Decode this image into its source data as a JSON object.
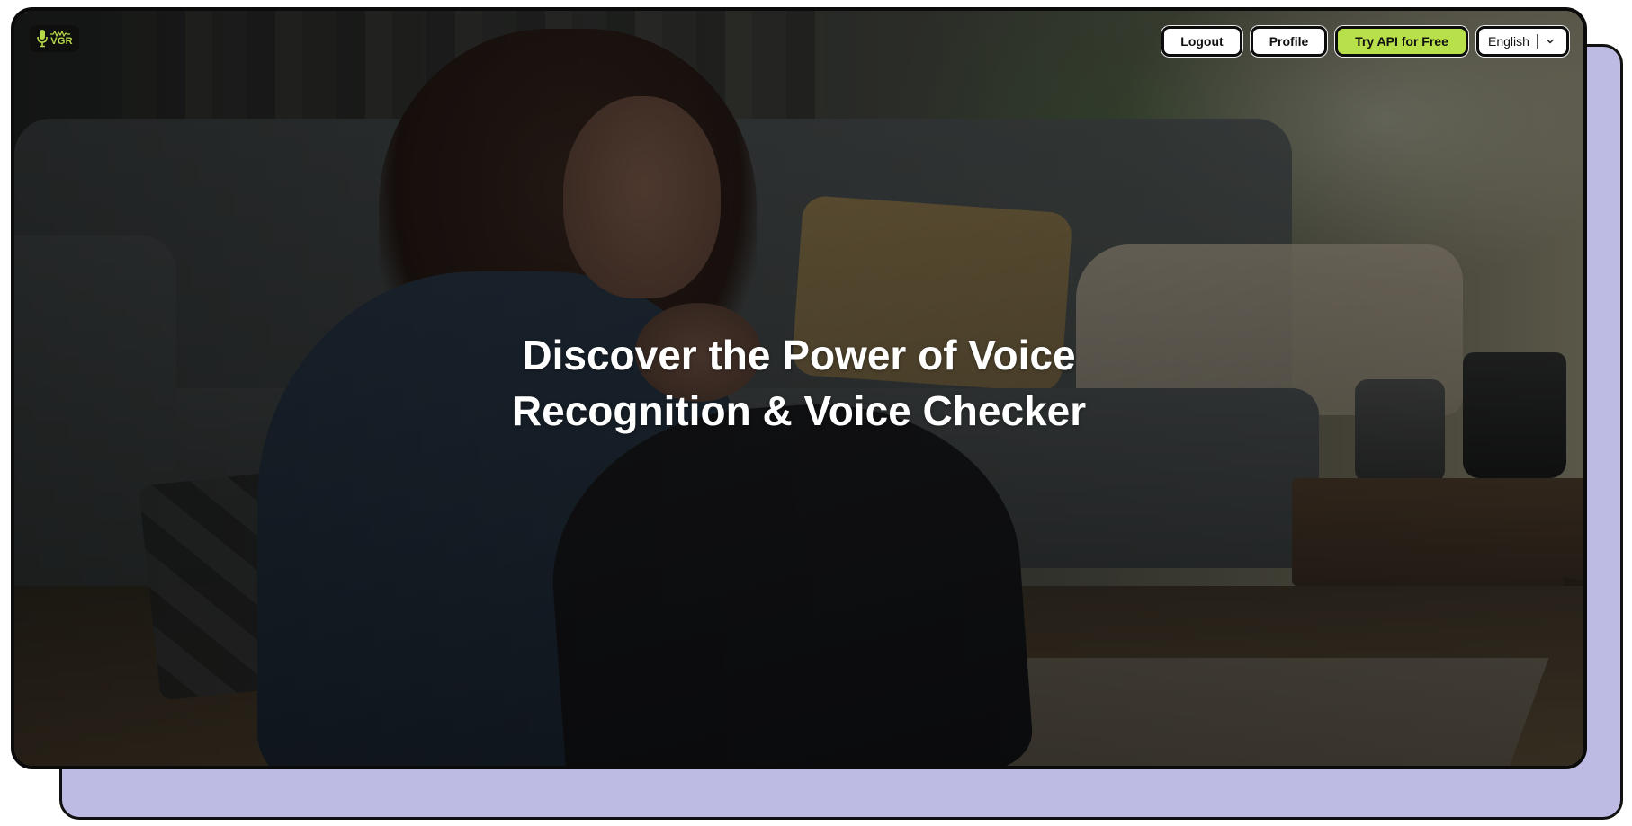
{
  "brand": {
    "logo_text": "VGR",
    "logo_icon": "microphone-waveform-icon",
    "accent_color": "#b7e04a"
  },
  "nav": {
    "logout_label": "Logout",
    "profile_label": "Profile",
    "try_api_label": "Try API for Free",
    "language": {
      "selected": "English",
      "icon": "chevron-down-icon"
    }
  },
  "hero": {
    "title_line_1": "Discover the Power of Voice",
    "title_line_2": "Recognition & Voice Checker"
  },
  "colors": {
    "back_card": "#bdbbe3",
    "border": "#0b0b0b",
    "button_bg": "#ffffff",
    "primary_button_bg": "#b7e04a"
  }
}
